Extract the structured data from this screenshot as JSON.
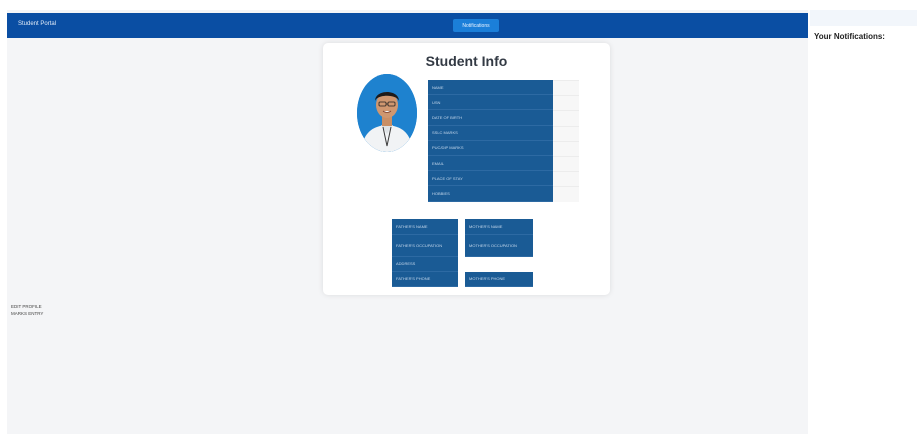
{
  "navbar": {
    "brand": "Student Portal",
    "notifications_button": "Notifications"
  },
  "card": {
    "title": "Student Info",
    "fields": [
      "NAME",
      "USN",
      "DATE OF BIRTH",
      "SSLC MARKS",
      "PUC/DIP MARKS",
      "EMAIL",
      "PLACE OF STAY",
      "HOBBIES"
    ]
  },
  "parents": {
    "left": [
      "FATHER'S NAME",
      "FATHER'S OCCUPATION",
      "ADDRESS",
      "FATHER'S PHONE"
    ],
    "right": [
      "MOTHER'S NAME",
      "MOTHER'S OCCUPATION",
      "MOTHER'S PHONE"
    ]
  },
  "side_links": {
    "edit_profile": "EDIT PROFILE",
    "marks_entry": "MARKS ENTRY"
  },
  "notifications": {
    "heading": "Your Notifications:"
  },
  "colors": {
    "navbar": "#0a4ea3",
    "table_cell": "#1a5b95",
    "button": "#1b7fd9"
  },
  "icons": [
    "student-avatar-photo"
  ]
}
